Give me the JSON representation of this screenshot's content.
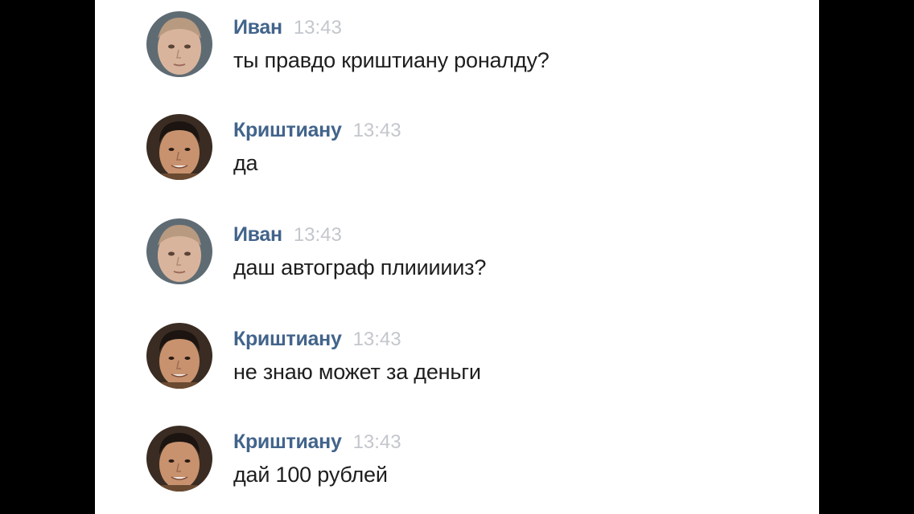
{
  "chat": {
    "messages": [
      {
        "author": "Иван",
        "time": "13:43",
        "text": "ты правдо криштиану роналду?",
        "avatar": "boy-avatar"
      },
      {
        "author": "Криштиану",
        "time": "13:43",
        "text": "да",
        "avatar": "man-avatar"
      },
      {
        "author": "Иван",
        "time": "13:43",
        "text": "даш автограф плиииииз?",
        "avatar": "boy-avatar"
      },
      {
        "author": "Криштиану",
        "time": "13:43",
        "text": "не знаю может за деньги",
        "avatar": "man-avatar"
      },
      {
        "author": "Криштиану",
        "time": "13:43",
        "text": "дай 100 рублей",
        "avatar": "man-avatar"
      }
    ]
  },
  "colors": {
    "author_name": "#42648b",
    "timestamp": "#c3c7cc",
    "message_text": "#1e1e1e",
    "panel_background": "#ffffff",
    "side_bars": "#000000"
  }
}
